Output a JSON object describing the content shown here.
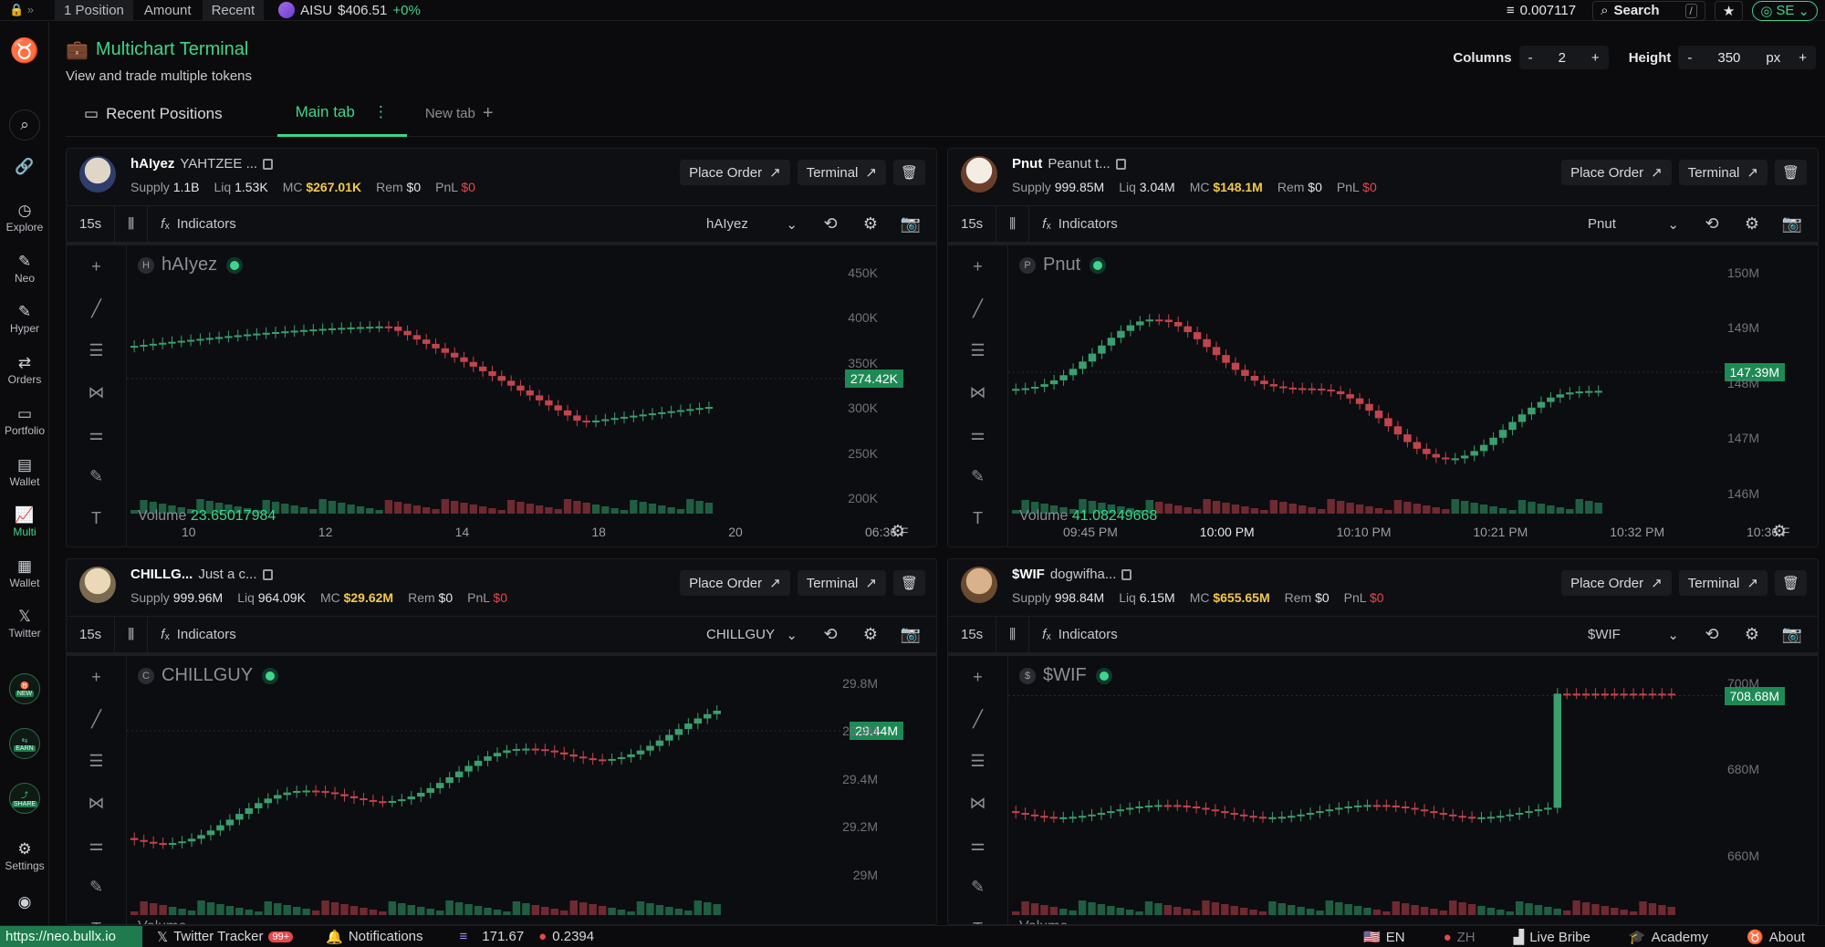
{
  "topbar": {
    "tabs": [
      "1 Position",
      "Amount",
      "Recent"
    ],
    "ticker": {
      "symbol": "AISU",
      "price": "$406.51",
      "change": "+0%"
    },
    "balance": "0.007117",
    "search_label": "Search",
    "search_shortcut": "/",
    "account": "SE"
  },
  "sidebar": {
    "items": [
      "Explore",
      "Neo",
      "Hyper",
      "Orders",
      "Portfolio",
      "Wallet",
      "Multi",
      "Wallet",
      "Twitter"
    ],
    "badges": [
      "NEW",
      "EARN",
      "SHARE"
    ],
    "settings_label": "Settings"
  },
  "header": {
    "title": "Multichart Terminal",
    "subtitle": "View and trade multiple tokens",
    "columns_label": "Columns",
    "columns_value": "2",
    "height_label": "Height",
    "height_value": "350",
    "height_unit": "px",
    "minus": "-",
    "plus": "+"
  },
  "tabs": {
    "recent": "Recent Positions",
    "main": "Main tab",
    "new": "New tab"
  },
  "common": {
    "place_order": "Place Order",
    "terminal": "Terminal",
    "indicators": "Indicators",
    "interval": "15s",
    "volume": "Volume",
    "supply": "Supply",
    "liq": "Liq",
    "mc": "MC",
    "rem": "Rem",
    "pnl": "PnL"
  },
  "colors": {
    "accent": "#3dd68c",
    "up": "#3dd68c",
    "down": "#e5484d",
    "mc": "#f2c94c"
  },
  "panels": [
    {
      "symbol": "hAIyez",
      "name": "YAHTZEE ...",
      "supply": "1.1B",
      "liq": "1.53K",
      "mc": "$267.01K",
      "rem": "$0",
      "pnl": "$0",
      "select": "hAIyez",
      "legend": "hAIyez",
      "legend_letter": "H",
      "volume": "23.65017984",
      "price_tag": "274.42K",
      "y_labels": [
        "450K",
        "400K",
        "350K",
        "300K",
        "250K",
        "200K"
      ],
      "x_labels": [
        "10",
        "12",
        "14",
        "18",
        "20",
        "06:36 F"
      ]
    },
    {
      "symbol": "Pnut",
      "name": "Peanut t...",
      "supply": "999.85M",
      "liq": "3.04M",
      "mc": "$148.1M",
      "rem": "$0",
      "pnl": "$0",
      "select": "Pnut",
      "legend": "Pnut",
      "legend_letter": "P",
      "volume": "41.08249668",
      "price_tag": "147.39M",
      "y_labels": [
        "150M",
        "149M",
        "148M",
        "147M",
        "146M"
      ],
      "x_labels": [
        "09:45 PM",
        "10:00 PM",
        "10:10 PM",
        "10:21 PM",
        "10:32 PM",
        "10:36 F"
      ]
    },
    {
      "symbol": "CHILLG...",
      "name": "Just a c...",
      "supply": "999.96M",
      "liq": "964.09K",
      "mc": "$29.62M",
      "rem": "$0",
      "pnl": "$0",
      "select": "CHILLGUY",
      "legend": "CHILLGUY",
      "legend_letter": "C",
      "volume": "",
      "price_tag": "29.44M",
      "y_labels": [
        "29.8M",
        "29.6M",
        "29.4M",
        "29.2M",
        "29M"
      ],
      "x_labels": []
    },
    {
      "symbol": "$WIF",
      "name": "dogwifha...",
      "supply": "998.84M",
      "liq": "6.15M",
      "mc": "$655.65M",
      "rem": "$0",
      "pnl": "$0",
      "select": "$WIF",
      "legend": "$WIF",
      "legend_letter": "$",
      "volume": "",
      "price_tag": "708.68M",
      "y_labels": [
        "700M",
        "680M",
        "660M"
      ],
      "x_labels": []
    }
  ],
  "bottombar": {
    "url": "https://neo.bullx.io",
    "twitter_tracker": "Twitter Tracker",
    "twitter_badge": "99+",
    "notifications": "Notifications",
    "sol_price": "171.67",
    "other_price": "0.2394",
    "lang_en": "EN",
    "lang_zh": "ZH",
    "live_bribe": "Live Bribe",
    "academy": "Academy",
    "about": "About"
  }
}
